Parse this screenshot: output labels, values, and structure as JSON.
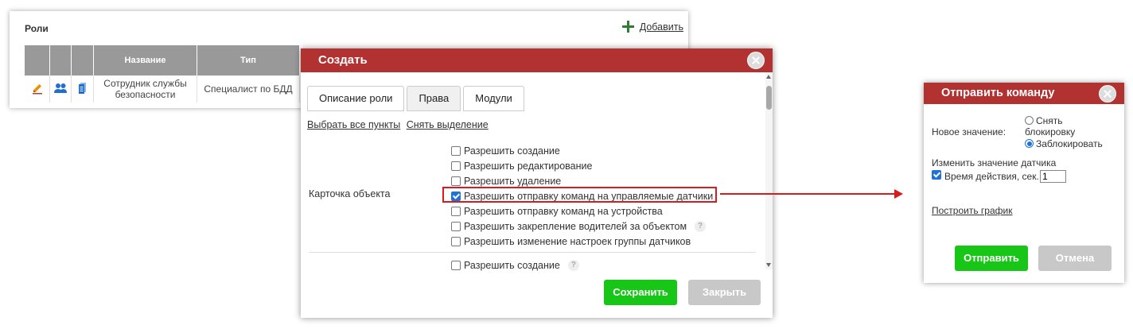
{
  "roles_panel": {
    "title": "Роли",
    "add_label": "Добавить",
    "columns": [
      "",
      "",
      "",
      "Название",
      "Тип"
    ],
    "rows": [
      {
        "name": "Сотрудник службы безопасности",
        "type": "Специалист по БДД"
      }
    ],
    "action_icons": [
      "edit-icon",
      "users-icon",
      "document-icon"
    ]
  },
  "create_dialog": {
    "title": "Создать",
    "tabs": [
      "Описание роли",
      "Права",
      "Модули"
    ],
    "active_tab": "Права",
    "select_all": "Выбрать все пункты",
    "deselect": "Снять выделение",
    "section_label": "Карточка объекта",
    "permissions": [
      {
        "label": "Разрешить создание",
        "checked": false,
        "help": false
      },
      {
        "label": "Разрешить редактирование",
        "checked": false,
        "help": false
      },
      {
        "label": "Разрешить удаление",
        "checked": false,
        "help": false
      },
      {
        "label": "Разрешить отправку команд на управляемые датчики",
        "checked": true,
        "help": false,
        "highlighted": true
      },
      {
        "label": "Разрешить отправку команд на устройства",
        "checked": false,
        "help": false
      },
      {
        "label": "Разрешить закрепление водителей за объектом",
        "checked": false,
        "help": true
      },
      {
        "label": "Разрешить изменение настроек группы датчиков",
        "checked": false,
        "help": false
      }
    ],
    "permissions_2": [
      {
        "label": "Разрешить создание",
        "checked": false,
        "help": true
      }
    ],
    "help_glyph": "?",
    "save_label": "Сохранить",
    "close_label": "Закрыть"
  },
  "send_dialog": {
    "title": "Отправить команду",
    "new_value_label": "Новое значение:",
    "radio_unlock_line1": "Снять",
    "radio_unlock_line2": "блокировку",
    "radio_unlock_checked": false,
    "radio_lock": "Заблокировать",
    "radio_lock_checked": true,
    "change_sensor_label": "Изменить значение датчика",
    "duration_label": "Время действия, сек.",
    "duration_checked": true,
    "duration_value": "1",
    "chart_link": "Построить график",
    "send_label": "Отправить",
    "cancel_label": "Отмена"
  },
  "colors": {
    "header_red": "#b23232",
    "button_green": "#17c617",
    "button_gray": "#c8c8c8",
    "highlight_red": "#d81c1c",
    "checkbox_blue": "#1e73d9"
  }
}
